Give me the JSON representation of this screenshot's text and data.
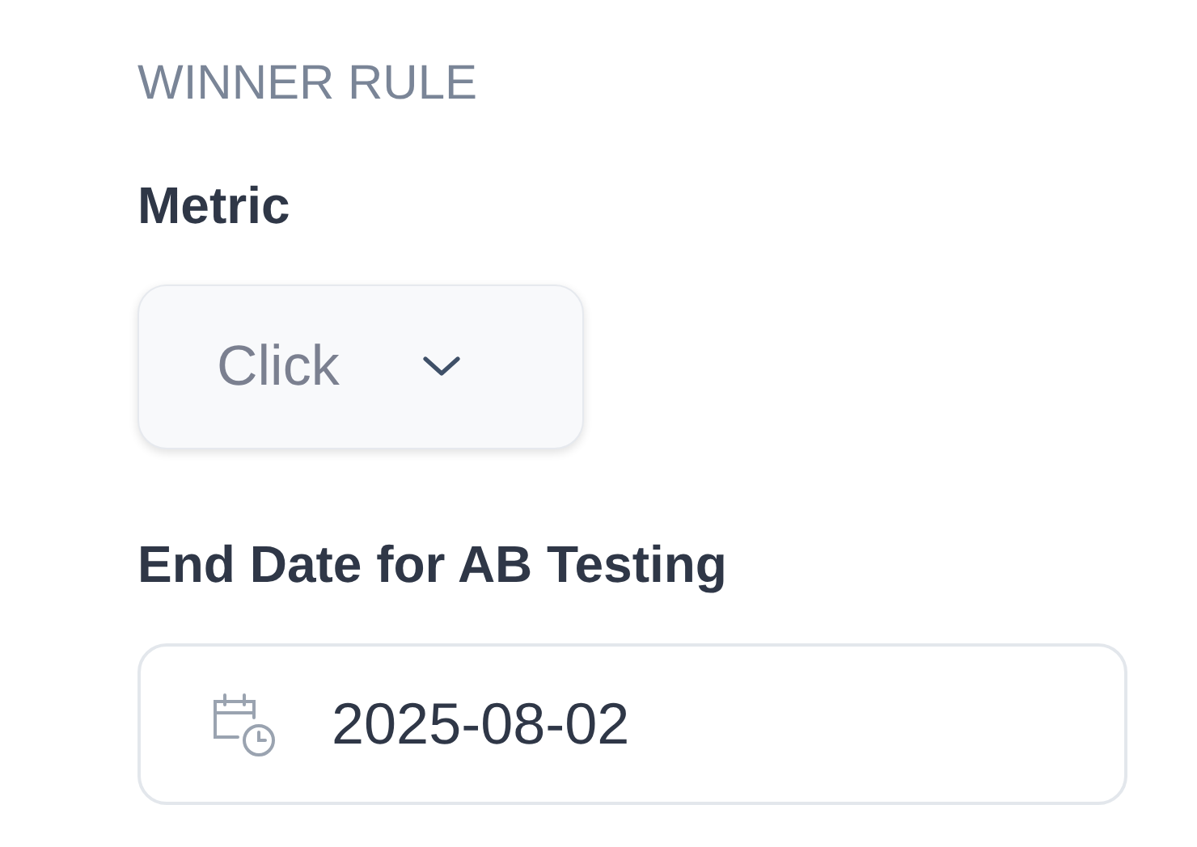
{
  "section_title": "WINNER RULE",
  "metric": {
    "label": "Metric",
    "value": "Click"
  },
  "end_date": {
    "label": "End Date for AB Testing",
    "value": "2025-08-02"
  }
}
